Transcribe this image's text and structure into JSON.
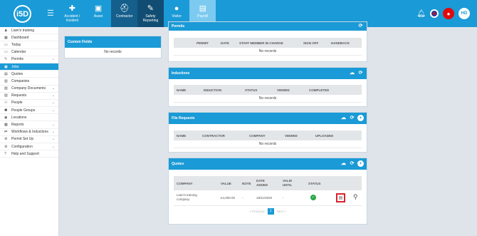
{
  "header": {
    "logo_text": "i5D",
    "menu_icon": "hamburger-icon",
    "nav": [
      {
        "label": "Accident / Incident",
        "icon": "first-aid-bag-icon"
      },
      {
        "label": "Asset",
        "icon": "cube-icon"
      },
      {
        "label": "Contractor",
        "icon": "workers-icon"
      },
      {
        "label": "Safety Reporting",
        "icon": "clipboard-icon"
      },
      {
        "label": "Visitor",
        "icon": "person-icon"
      },
      {
        "label": "Payroll",
        "icon": "money-icon"
      }
    ],
    "avatar": "HD",
    "colors": {
      "topbar": "#1a9ad6",
      "active": "#155f8c",
      "highlight": "#7ccaf0"
    }
  },
  "sidebar": {
    "items": [
      {
        "label": "Liam's training",
        "icon": "person-icon",
        "chevron": false
      },
      {
        "label": "Dashboard",
        "icon": "dashboard-icon",
        "chevron": false
      },
      {
        "label": "Today",
        "icon": "calendar-icon",
        "chevron": false
      },
      {
        "label": "Calendar",
        "icon": "calendar-icon",
        "chevron": false
      },
      {
        "label": "Permits",
        "icon": "permit-icon",
        "chevron": true
      },
      {
        "label": "Jobs",
        "icon": "briefcase-icon",
        "chevron": false
      },
      {
        "label": "Quotes",
        "icon": "document-icon",
        "chevron": false
      },
      {
        "label": "Companies",
        "icon": "building-icon",
        "chevron": false
      },
      {
        "label": "Company Documents",
        "icon": "folder-icon",
        "chevron": true
      },
      {
        "label": "Requests",
        "icon": "inbox-icon",
        "chevron": true
      },
      {
        "label": "People",
        "icon": "people-icon",
        "chevron": true
      },
      {
        "label": "People Groups",
        "icon": "group-icon",
        "chevron": true
      },
      {
        "label": "Locations",
        "icon": "location-icon",
        "chevron": false
      },
      {
        "label": "Reports",
        "icon": "chart-icon",
        "chevron": true
      },
      {
        "label": "Workflows & Inductions",
        "icon": "workflow-icon",
        "chevron": true
      },
      {
        "label": "Permit Set Up",
        "icon": "settings-icon",
        "chevron": true
      },
      {
        "label": "Configuration",
        "icon": "gear-icon",
        "chevron": true
      },
      {
        "label": "Help and Support",
        "icon": "help-icon",
        "chevron": false
      }
    ]
  },
  "custom_fields": {
    "title": "Custom Fields",
    "empty": "No records"
  },
  "permits": {
    "title": "Permits",
    "columns": [
      "PERMIT",
      "DATE",
      "STAFF MEMBER IN CHARGE",
      "SIGN OFF",
      "HANDBACK"
    ],
    "empty": "No records"
  },
  "inductions": {
    "title": "Inductions",
    "columns": [
      "NAME",
      "INDUCTION",
      "STATUS",
      "VIEWED",
      "COMPLETED"
    ],
    "empty": "No records"
  },
  "file_requests": {
    "title": "File Requests",
    "columns": [
      "NAME",
      "CONTRACTOR",
      "COMPANY",
      "VIEWED",
      "UPLOADED"
    ],
    "empty": "No records"
  },
  "quotes": {
    "title": "Quotes",
    "columns": [
      "COMPANY",
      "VALUE",
      "NOTE",
      "DATE ADDED",
      "VALID UNTIL",
      "STATUS"
    ],
    "rows": [
      {
        "company": "Liam's training company",
        "value": "£4,000.00",
        "note": "-",
        "date_added": "18/11/2020",
        "valid_until": "-",
        "status": "approved"
      }
    ],
    "pager": {
      "prev": "« Previous",
      "page": "1",
      "next": "Next »"
    }
  }
}
